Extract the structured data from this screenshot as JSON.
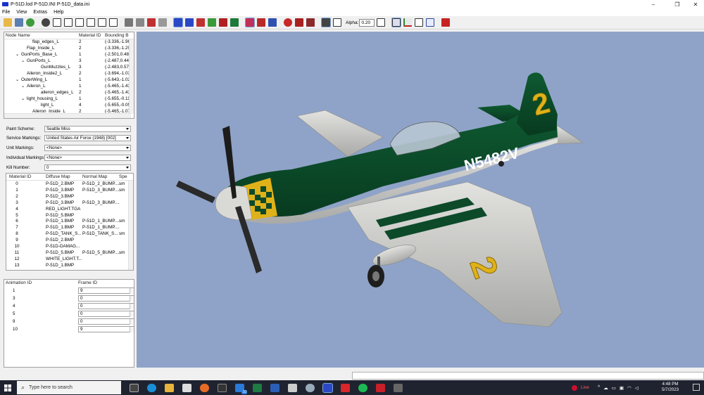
{
  "title": "P-51D.lod  P-51D.INI  P-51D_data.ini",
  "window_controls": {
    "minimize": "–",
    "maximize": "❐",
    "close": "✕"
  },
  "menu": [
    "File",
    "View",
    "Extras",
    "Help"
  ],
  "toolbar": {
    "alpha_label": "Alpha:",
    "alpha_value": "0.20"
  },
  "node_tree": {
    "columns": [
      "Node Name",
      "Material ID",
      "Bounding B"
    ],
    "rows": [
      {
        "name": "flap_edges_L",
        "expander": "",
        "material": "2",
        "bounds": "(-3.336,-1.96"
      },
      {
        "name": "Flap_Inside_L",
        "expander": "",
        "material": "2",
        "bounds": "(-3.336,-1.29"
      },
      {
        "name": "GunPorts_Base_L",
        "expander": "⌄",
        "material": "1",
        "bounds": "(-2.501,0.480"
      },
      {
        "name": "GunPorts_L",
        "expander": "⌄",
        "material": "3",
        "bounds": "(-2.487,0.446"
      },
      {
        "name": "GunMuzzles_L",
        "expander": "",
        "material": "3",
        "bounds": "(-2.483,0.579"
      },
      {
        "name": "Aileron_Inside2_L",
        "expander": "",
        "material": "2",
        "bounds": "(-3.694,-1.03"
      },
      {
        "name": "OuterWing_L",
        "expander": "⌄",
        "material": "1",
        "bounds": "(-5.643,-1.02"
      },
      {
        "name": "Aileron_L",
        "expander": "⌄",
        "material": "1",
        "bounds": "(-5.465,-1.43"
      },
      {
        "name": "aileron_edges_L",
        "expander": "",
        "material": "2",
        "bounds": "(-5.465,-1.43"
      },
      {
        "name": "light_housing_L",
        "expander": "⌄",
        "material": "1",
        "bounds": "(-5.655,-0.11"
      },
      {
        "name": "light_L",
        "expander": "",
        "material": "4",
        "bounds": "(-5.655,-0.05"
      },
      {
        "name": "Aileron_Inside_L",
        "expander": "",
        "material": "2",
        "bounds": "(-5.465,-1.07"
      }
    ]
  },
  "options": {
    "paint_scheme": {
      "label": "Paint Scheme:",
      "value": "Seattle Miss"
    },
    "service_markings": {
      "label": "Service Markings:",
      "value": "United States Air Force (1948) [002]"
    },
    "unit_markings": {
      "label": "Unit Markings:",
      "value": "<None>"
    },
    "individual_markings": {
      "label": "Individual Markings:",
      "value": "<None>"
    },
    "kill_number": {
      "label": "Kill Number:",
      "value": "0"
    }
  },
  "materials": {
    "columns": [
      "Material ID",
      "Diffuse Map",
      "Normal Map",
      "Spe"
    ],
    "rows": [
      {
        "id": "0",
        "diffuse": "P-51D_2.BMP",
        "normal": "P-51D_2_BUMP....",
        "spec": "sm"
      },
      {
        "id": "1",
        "diffuse": "P-51D_3.BMP",
        "normal": "P-51D_3_BUMP....",
        "spec": "sm"
      },
      {
        "id": "2",
        "diffuse": "P-51D_3.BMP",
        "normal": "",
        "spec": ""
      },
      {
        "id": "3",
        "diffuse": "P-51D_3.BMP",
        "normal": "P-51D_3_BUMP....",
        "spec": ""
      },
      {
        "id": "4",
        "diffuse": "RED_LIGHT.TGA",
        "normal": "",
        "spec": ""
      },
      {
        "id": "5",
        "diffuse": "P-51D_5.BMP",
        "normal": "",
        "spec": ""
      },
      {
        "id": "6",
        "diffuse": "P-51D_1.BMP",
        "normal": "P-51D_1_BUMP....",
        "spec": "sm"
      },
      {
        "id": "7",
        "diffuse": "P-51D_1.BMP",
        "normal": "P-51D_1_BUMP....",
        "spec": ""
      },
      {
        "id": "8",
        "diffuse": "P-51D_TANK_S...",
        "normal": "P-51D_TANK_S...",
        "spec": "sm"
      },
      {
        "id": "9",
        "diffuse": "P-51D_2.BMP",
        "normal": "",
        "spec": ""
      },
      {
        "id": "10",
        "diffuse": "P-51D-DAMAG...",
        "normal": "",
        "spec": ""
      },
      {
        "id": "11",
        "diffuse": "P-51D_5.BMP",
        "normal": "P-51D_5_BUMP....",
        "spec": "sm"
      },
      {
        "id": "12",
        "diffuse": "WHITE_LIGHT.T...",
        "normal": "",
        "spec": ""
      },
      {
        "id": "13",
        "diffuse": "P-51D_1.BMP",
        "normal": "",
        "spec": ""
      }
    ]
  },
  "animations": {
    "columns": [
      "Animation ID",
      "Frame ID"
    ],
    "rows": [
      {
        "anim": "1",
        "frame": "9"
      },
      {
        "anim": "3",
        "frame": "0"
      },
      {
        "anim": "4",
        "frame": "0"
      },
      {
        "anim": "5",
        "frame": "0"
      },
      {
        "anim": "9",
        "frame": "0"
      },
      {
        "anim": "10",
        "frame": "9"
      }
    ]
  },
  "aircraft": {
    "registration": "N5482V",
    "tail_number": "2",
    "wing_number": "2",
    "colors": {
      "green": "#0d4a2a",
      "yellow": "#e0b219",
      "silver": "#c9c9c6",
      "background": "#8fa3c8"
    }
  },
  "taskbar": {
    "search_placeholder": "Type here to search",
    "live_label": "Live",
    "time": "4:48 PM",
    "date": "5/7/2023",
    "mail_badge": "10"
  }
}
